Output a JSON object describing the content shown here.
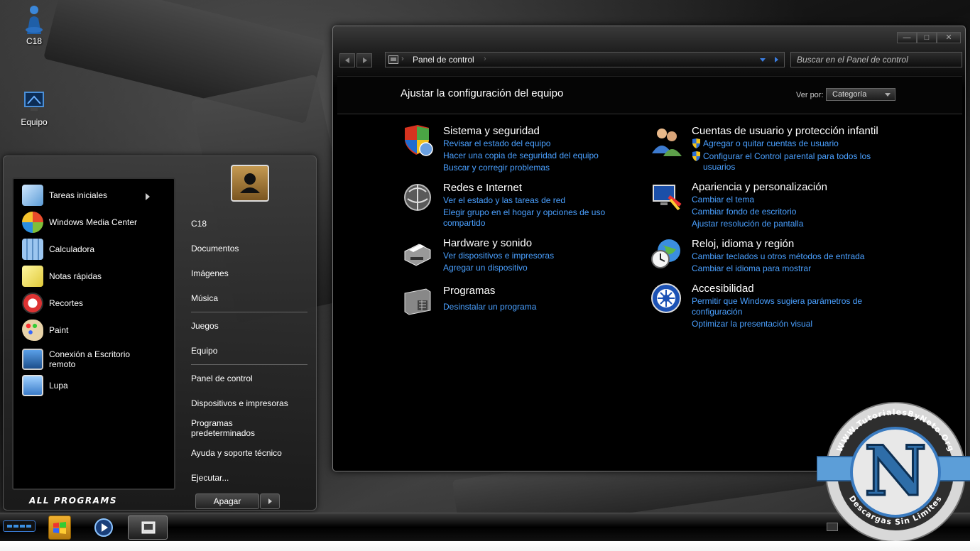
{
  "desktop": {
    "icons": [
      {
        "label": "C18"
      },
      {
        "label": "Equipo"
      }
    ]
  },
  "start_menu": {
    "programs": [
      {
        "label": "Tareas iniciales"
      },
      {
        "label": "Windows Media Center"
      },
      {
        "label": "Calculadora"
      },
      {
        "label": "Notas rápidas"
      },
      {
        "label": "Recortes"
      },
      {
        "label": "Paint"
      },
      {
        "label": "Conexión a Escritorio\nremoto"
      },
      {
        "label": "Lupa"
      }
    ],
    "all_programs": "ALL PROGRAMS",
    "right_items": [
      "C18",
      "Documentos",
      "Imágenes",
      "Música",
      "Juegos",
      "Equipo",
      "Panel de control",
      "Dispositivos e impresoras",
      "Programas\npredeterminados",
      "Ayuda y soporte técnico",
      "Ejecutar..."
    ],
    "shutdown_label": "Apagar"
  },
  "window": {
    "controls": [
      "—",
      "□",
      "✕"
    ],
    "breadcrumb": "Panel de control",
    "search_placeholder": "Buscar en el Panel de control",
    "page_title": "Ajustar la configuración del equipo",
    "view_by_label": "Ver por:",
    "view_by_value": "Categoría",
    "categories": [
      {
        "title": "Sistema y seguridad",
        "links": [
          "Revisar el estado del equipo",
          "Hacer una copia de seguridad del equipo",
          "Buscar y corregir problemas"
        ]
      },
      {
        "title": "Redes e Internet",
        "links": [
          "Ver el estado y las tareas de red",
          "Elegir grupo en el hogar y opciones de uso",
          "compartido"
        ]
      },
      {
        "title": "Hardware y sonido",
        "links": [
          "Ver dispositivos e impresoras",
          "Agregar un dispositivo"
        ]
      },
      {
        "title": "Programas",
        "links": [
          "Desinstalar un programa"
        ]
      },
      {
        "title": "Cuentas de usuario y protección infantil",
        "links": [
          "Agregar o quitar cuentas de usuario",
          "Configurar el Control parental para todos los",
          "usuarios"
        ]
      },
      {
        "title": "Apariencia y personalización",
        "links": [
          "Cambiar el tema",
          "Cambiar fondo de escritorio",
          "Ajustar resolución de pantalla"
        ]
      },
      {
        "title": "Reloj, idioma y región",
        "links": [
          "Cambiar teclados u otros métodos de entrada",
          "Cambiar el idioma para mostrar"
        ]
      },
      {
        "title": "Accesibilidad",
        "links": [
          "Permitir que Windows sugiera parámetros de",
          "configuración",
          "Optimizar la presentación visual"
        ]
      }
    ]
  },
  "watermark": {
    "top_text": "WWW.TutorialesByNeto.Org",
    "bottom_text": "Descargas Sin Limites",
    "letter": "N"
  },
  "colors": {
    "link": "#4aa0ff",
    "badge_blue": "#5c9ed8"
  }
}
